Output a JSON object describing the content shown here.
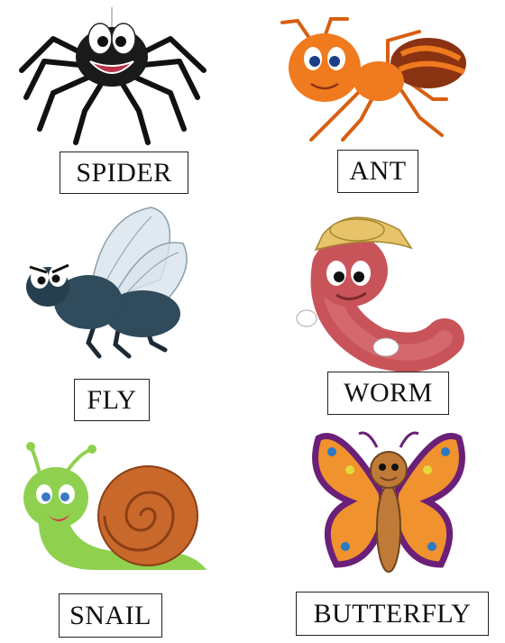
{
  "cards": [
    {
      "id": "spider",
      "label": "SPIDER",
      "icon": "spider-icon"
    },
    {
      "id": "ant",
      "label": "ANT",
      "icon": "ant-icon"
    },
    {
      "id": "fly",
      "label": "FLY",
      "icon": "fly-icon"
    },
    {
      "id": "worm",
      "label": "WORM",
      "icon": "worm-icon"
    },
    {
      "id": "snail",
      "label": "SNAIL",
      "icon": "snail-icon"
    },
    {
      "id": "butterfly",
      "label": "BUTTERFLY",
      "icon": "butterfly-icon"
    }
  ],
  "colors": {
    "spider": "#1a1a1a",
    "ant": "#f07a1e",
    "fly": "#2f4b5c",
    "worm": "#c8545a",
    "hat": "#e7c36a",
    "snail_body": "#8fd14f",
    "snail_shell": "#c8682b",
    "butterfly_wing": "#f0922e",
    "butterfly_border": "#6c1f78"
  }
}
